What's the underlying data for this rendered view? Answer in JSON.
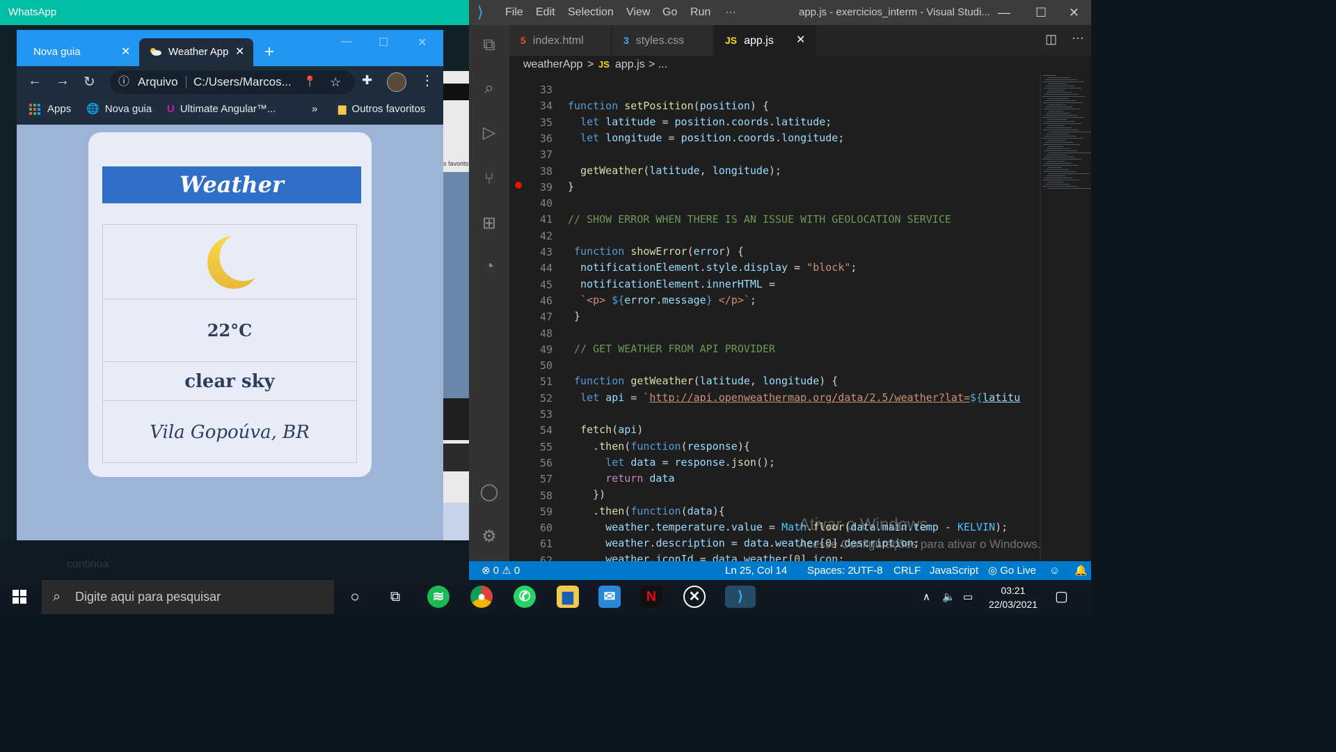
{
  "whatsapp": {
    "title": "WhatsApp",
    "side_label": "s favorito",
    "chat_text": "continua"
  },
  "chrome": {
    "tabs": [
      {
        "label": "Nova guia",
        "active": false
      },
      {
        "label": "Weather App",
        "active": true
      }
    ],
    "address": {
      "scheme": "Arquivo",
      "url": "C:/Users/Marcos..."
    },
    "bookmarks": {
      "apps": "Apps",
      "items": [
        "Nova guia",
        "Ultimate Angular™..."
      ],
      "overflow": "»",
      "other": "Outros favoritos"
    }
  },
  "weather": {
    "title": "Weather",
    "icon": "moon-icon",
    "temperature": "22°C",
    "description": "clear sky",
    "location": "Vila Gopoúva, BR"
  },
  "vscode": {
    "menu": [
      "File",
      "Edit",
      "Selection",
      "View",
      "Go",
      "Run",
      "···"
    ],
    "window_title": "app.js - exercicios_interm - Visual Studi...",
    "tabs": [
      {
        "icon": "5",
        "label": "index.html",
        "active": false
      },
      {
        "icon": "3",
        "label": "styles.css",
        "active": false
      },
      {
        "icon": "JS",
        "label": "app.js",
        "active": true
      }
    ],
    "breadcrumb": {
      "folder": "weatherApp",
      "sep": ">",
      "js_tag": "JS",
      "file": "app.js",
      "tail": "> ..."
    },
    "line_numbers": [
      33,
      34,
      35,
      36,
      37,
      38,
      39,
      40,
      41,
      42,
      43,
      44,
      45,
      46,
      47,
      48,
      49,
      50,
      51,
      52,
      53,
      54,
      55,
      56,
      57,
      58,
      59,
      60,
      61,
      62
    ],
    "breakpoint_line": 39,
    "watermark": {
      "title": "Ativar o Windows",
      "sub": "Acesse Configurações para ativar o Windows."
    },
    "status": {
      "errors": "0",
      "warnings": "0",
      "cursor": "Ln 25, Col 14",
      "spaces": "Spaces: 2",
      "encoding": "UTF-8",
      "eol": "CRLF",
      "language": "JavaScript",
      "golive": "Go Live"
    }
  },
  "taskbar": {
    "search_placeholder": "Digite aqui para pesquisar",
    "time": "03:21",
    "date": "22/03/2021"
  },
  "colors": {
    "chrome_tabbar": "#2196f3",
    "weather_header": "#2f6fc8",
    "vscode_status": "#007acc",
    "whatsapp_title": "#00bfa5"
  }
}
